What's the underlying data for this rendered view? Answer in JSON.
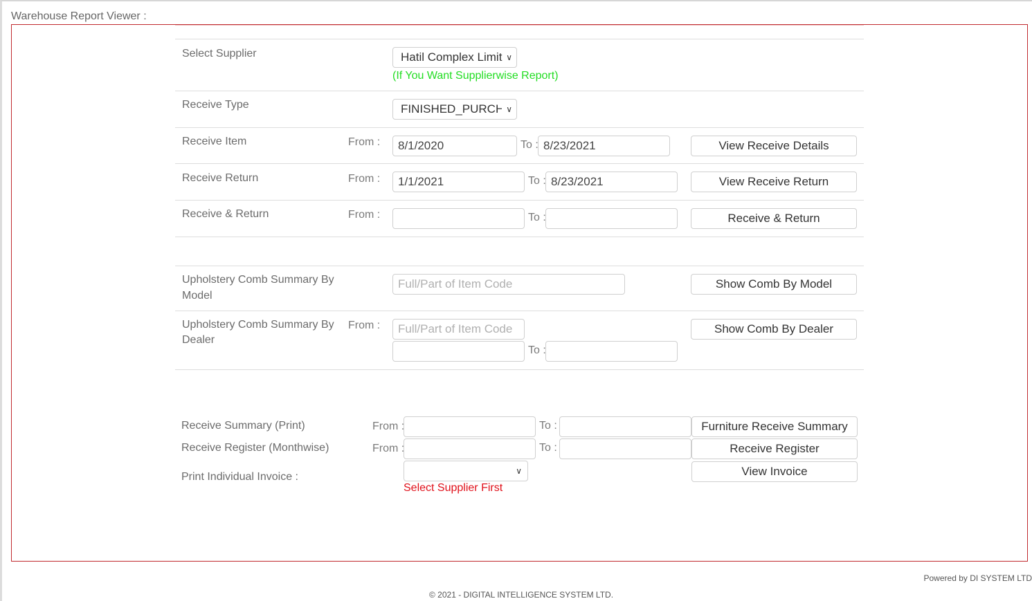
{
  "page": {
    "title": "Warehouse Report Viewer :"
  },
  "supplier": {
    "label": "Select Supplier",
    "selected": "Hatil Complex Limit",
    "hint": "(If You Want Supplierwise Report)"
  },
  "receive_type": {
    "label": "Receive Type",
    "selected": "FINISHED_PURCH"
  },
  "receive_item": {
    "label": "Receive Item",
    "from_label": "From :",
    "from_value": "8/1/2020",
    "to_label": "To :",
    "to_value": "8/23/2021",
    "button": "View Receive Details"
  },
  "receive_return": {
    "label": "Receive Return",
    "from_label": "From :",
    "from_value": "1/1/2021",
    "to_label": "To :",
    "to_value": "8/23/2021",
    "button": "View Receive Return"
  },
  "receive_and_return": {
    "label": "Receive & Return",
    "from_label": "From :",
    "from_value": "",
    "to_label": "To :",
    "to_value": "",
    "button": "Receive & Return"
  },
  "comb_by_model": {
    "label_line1": "Upholstery Comb Summary By",
    "label_line2": "Model",
    "item_code_placeholder": "Full/Part of Item Code",
    "button": "Show Comb By Model"
  },
  "comb_by_dealer": {
    "label_line1": "Upholstery Comb Summary By",
    "label_line2": "Dealer",
    "from_label": "From :",
    "item_code_placeholder": "Full/Part of Item Code",
    "from_value": "",
    "to_label": "To :",
    "to_value": "",
    "button": "Show Comb By Dealer"
  },
  "receive_summary": {
    "label": "Receive Summary (Print)",
    "from_label": "From :",
    "from_value": "",
    "to_label": "To :",
    "to_value": "",
    "button": "Furniture Receive Summary"
  },
  "receive_register": {
    "label": "Receive Register (Monthwise)",
    "from_label": "From :",
    "from_value": "",
    "to_label": "To :",
    "to_value": "",
    "button": "Receive Register"
  },
  "individual_invoice": {
    "label": "Print Individual Invoice :",
    "selected": "",
    "hint": "Select Supplier First",
    "button": "View Invoice"
  },
  "footer": {
    "powered_by": "Powered by DI SYSTEM LTD",
    "copyright": "© 2021 - DIGITAL INTELLIGENCE SYSTEM LTD."
  },
  "colors": {
    "frame_border": "#c0282d",
    "hint_green": "#22dd22",
    "hint_red": "#e0101a"
  }
}
